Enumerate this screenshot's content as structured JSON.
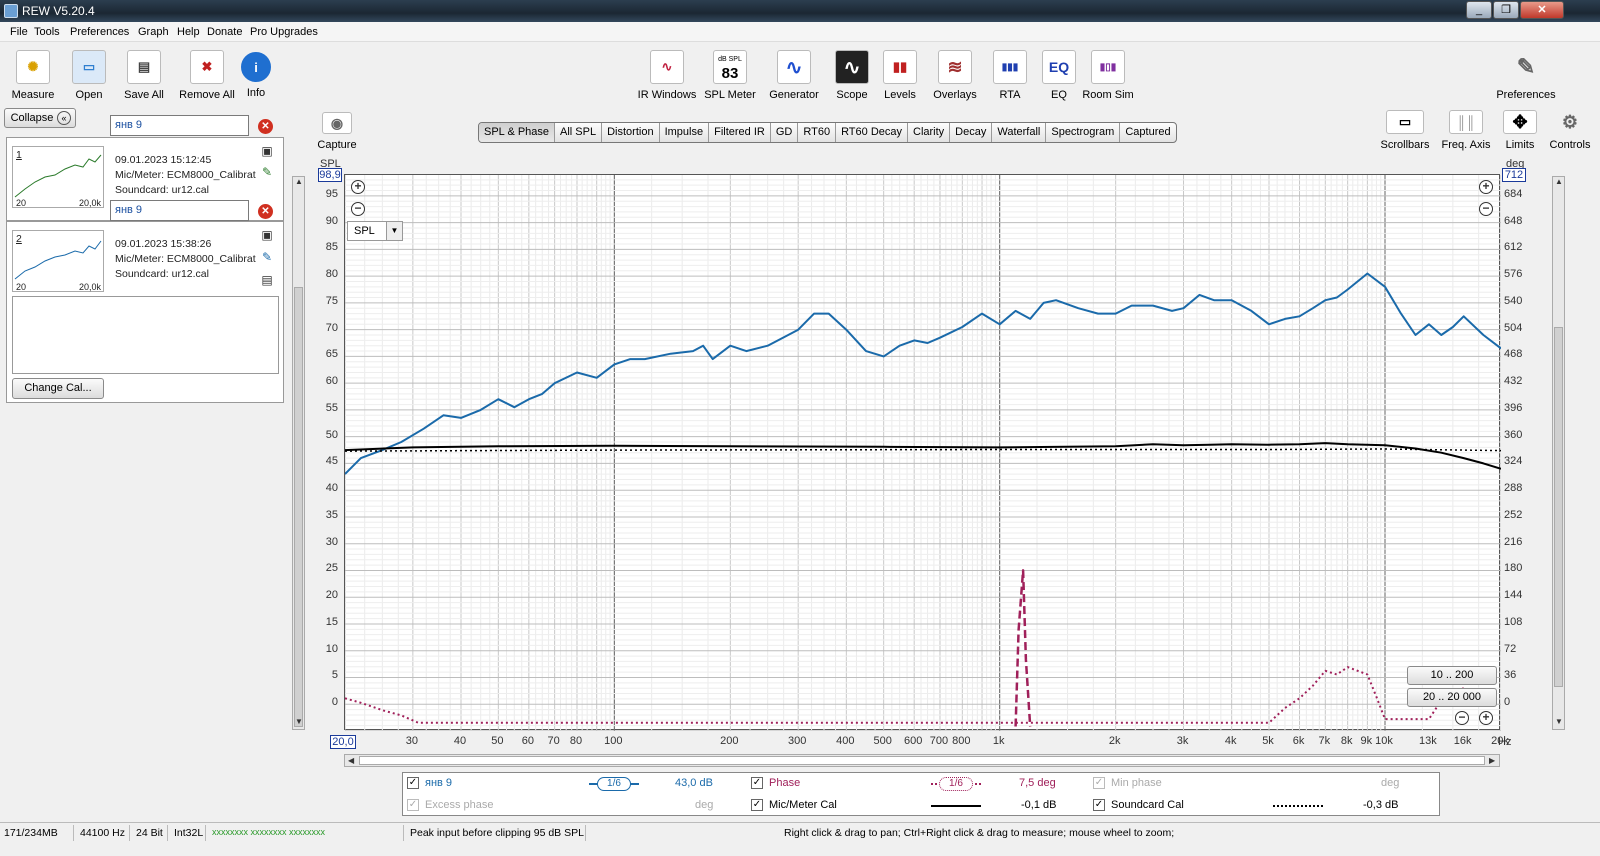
{
  "window": {
    "title": "REW V5.20.4",
    "controls": [
      "_",
      "❐",
      "✕"
    ]
  },
  "menu": [
    "File",
    "Tools",
    "Preferences",
    "Graph",
    "Help",
    "Donate",
    "Pro Upgrades"
  ],
  "toolbar_left": [
    {
      "label": "Measure",
      "icon": "measure-icon",
      "glyph": "✺"
    },
    {
      "label": "Open",
      "icon": "folder-icon",
      "glyph": "▭"
    },
    {
      "label": "Save All",
      "icon": "save-icon",
      "glyph": "▤"
    },
    {
      "label": "Remove All",
      "icon": "remove-icon",
      "glyph": "✖"
    },
    {
      "label": "Info",
      "icon": "info-icon",
      "glyph": "i"
    }
  ],
  "toolbar_center": [
    {
      "label": "IR Windows",
      "icon": "ir-windows-icon",
      "glyph": "∿"
    },
    {
      "label": "SPL Meter",
      "icon": "spl-meter-icon",
      "glyph": "83",
      "sub": "dB SPL"
    },
    {
      "label": "Generator",
      "icon": "generator-icon",
      "glyph": "∿"
    },
    {
      "label": "Scope",
      "icon": "scope-icon",
      "glyph": "∿"
    },
    {
      "label": "Levels",
      "icon": "levels-icon",
      "glyph": "▮▮"
    },
    {
      "label": "Overlays",
      "icon": "overlays-icon",
      "glyph": "≋"
    },
    {
      "label": "RTA",
      "icon": "rta-icon",
      "glyph": "▮▮▮"
    },
    {
      "label": "EQ",
      "icon": "eq-icon",
      "glyph": "EQ"
    },
    {
      "label": "Room Sim",
      "icon": "room-sim-icon",
      "glyph": "▮▯▮"
    }
  ],
  "toolbar_right": {
    "label": "Preferences",
    "icon": "wrench-icon",
    "glyph": "✎"
  },
  "graph_tools": [
    {
      "label": "Scrollbars",
      "icon": "scrollbars-icon",
      "glyph": "▭"
    },
    {
      "label": "Freq. Axis",
      "icon": "freq-axis-icon",
      "glyph": "║║"
    },
    {
      "label": "Limits",
      "icon": "limits-icon",
      "glyph": "✥"
    },
    {
      "label": "Controls",
      "icon": "gear-icon",
      "glyph": "⚙"
    }
  ],
  "capture": {
    "label": "Capture",
    "icon": "camera-icon",
    "glyph": "◉"
  },
  "collapse_label": "Collapse",
  "measurements": [
    {
      "num": "1",
      "name": "янв 9",
      "date": "09.01.2023 15:12:45",
      "mic": "Mic/Meter: ECM8000_Calibrat",
      "soundcard": "Soundcard: ur12.cal",
      "thumb_lo": "20",
      "thumb_hi": "20,0k",
      "color": "#2a7a2a"
    },
    {
      "num": "2",
      "name": "янв 9",
      "date": "09.01.2023 15:38:26",
      "mic": "Mic/Meter: ECM8000_Calibrat",
      "soundcard": "Soundcard: ur12.cal",
      "thumb_lo": "20",
      "thumb_hi": "20,0k",
      "color": "#1a6aaa"
    }
  ],
  "change_cal_label": "Change Cal...",
  "tabs": [
    "SPL & Phase",
    "All SPL",
    "Distortion",
    "Impulse",
    "Filtered IR",
    "GD",
    "RT60",
    "RT60 Decay",
    "Clarity",
    "Decay",
    "Waterfall",
    "Spectrogram",
    "Captured"
  ],
  "selected_tab": "SPL & Phase",
  "graph": {
    "left_axis_title": "SPL",
    "right_axis_title": "deg",
    "top_left_value": "98,9",
    "top_right_value": "712",
    "bottom_left_value": "20,0",
    "freq_unit": "Hz",
    "spl_selector": "SPL",
    "range_buttons": [
      "10 .. 200",
      "20 .. 20 000"
    ]
  },
  "chart_data": {
    "type": "line",
    "title": "",
    "xlabel": "",
    "ylabel": "SPL",
    "y2label": "deg",
    "x_scale": "log",
    "xlim": [
      20,
      20000
    ],
    "ylim": [
      -5,
      98.9
    ],
    "y2lim": [
      -36,
      712
    ],
    "grid": true,
    "x_ticks": [
      {
        "v": 30,
        "l": "30"
      },
      {
        "v": 40,
        "l": "40"
      },
      {
        "v": 50,
        "l": "50"
      },
      {
        "v": 60,
        "l": "60"
      },
      {
        "v": 70,
        "l": "70"
      },
      {
        "v": 80,
        "l": "80"
      },
      {
        "v": 100,
        "l": "100"
      },
      {
        "v": 200,
        "l": "200"
      },
      {
        "v": 300,
        "l": "300"
      },
      {
        "v": 400,
        "l": "400"
      },
      {
        "v": 500,
        "l": "500"
      },
      {
        "v": 600,
        "l": "600"
      },
      {
        "v": 700,
        "l": "700"
      },
      {
        "v": 800,
        "l": "800"
      },
      {
        "v": 1000,
        "l": "1k"
      },
      {
        "v": 2000,
        "l": "2k"
      },
      {
        "v": 3000,
        "l": "3k"
      },
      {
        "v": 4000,
        "l": "4k"
      },
      {
        "v": 5000,
        "l": "5k"
      },
      {
        "v": 6000,
        "l": "6k"
      },
      {
        "v": 7000,
        "l": "7k"
      },
      {
        "v": 8000,
        "l": "8k"
      },
      {
        "v": 9000,
        "l": "9k"
      },
      {
        "v": 10000,
        "l": "10k"
      },
      {
        "v": 13000,
        "l": "13k"
      },
      {
        "v": 16000,
        "l": "16k"
      },
      {
        "v": 20000,
        "l": "20k"
      }
    ],
    "y_ticks": [
      0,
      5,
      10,
      15,
      20,
      25,
      30,
      35,
      40,
      45,
      50,
      55,
      60,
      65,
      70,
      75,
      80,
      85,
      90,
      95
    ],
    "y2_ticks": [
      0,
      36,
      72,
      108,
      144,
      180,
      216,
      252,
      288,
      324,
      360,
      396,
      432,
      468,
      504,
      540,
      576,
      612,
      648,
      684
    ],
    "series": [
      {
        "name": "янв 9",
        "color": "#1a6aaa",
        "style": "solid",
        "width": 2,
        "x": [
          20,
          22,
          25,
          28,
          32,
          36,
          40,
          45,
          50,
          55,
          60,
          65,
          70,
          80,
          90,
          100,
          110,
          120,
          140,
          160,
          170,
          180,
          200,
          220,
          250,
          300,
          330,
          360,
          400,
          450,
          500,
          550,
          600,
          650,
          700,
          800,
          900,
          1000,
          1100,
          1200,
          1300,
          1400,
          1600,
          1800,
          2000,
          2200,
          2500,
          2800,
          3000,
          3300,
          3600,
          4000,
          4500,
          5000,
          5500,
          6000,
          6500,
          7000,
          7500,
          8000,
          9000,
          10000,
          11000,
          12000,
          13000,
          14000,
          15000,
          16000,
          18000,
          20000
        ],
        "y": [
          43,
          46,
          47.5,
          49,
          51.5,
          54,
          53.5,
          55,
          57,
          55.5,
          57,
          58,
          60,
          62,
          61,
          63.5,
          64.5,
          64.5,
          65.5,
          66,
          67,
          64.5,
          67,
          66,
          67,
          70,
          73,
          73,
          70,
          66,
          65,
          67,
          68,
          67.5,
          68.5,
          70.5,
          73,
          71,
          73.5,
          72,
          75,
          75.5,
          74,
          73,
          73,
          74.5,
          74.5,
          73.5,
          74,
          76.5,
          75.5,
          75.5,
          73.5,
          71,
          72,
          72.5,
          74,
          75.5,
          76,
          77.5,
          80.5,
          78,
          73,
          69,
          71,
          69,
          70.5,
          72.5,
          69,
          66.5
        ]
      },
      {
        "name": "Mic/Meter Cal",
        "color": "#000000",
        "style": "solid",
        "width": 2,
        "x": [
          20,
          30,
          50,
          100,
          200,
          500,
          1000,
          2000,
          2500,
          3000,
          3500,
          4000,
          5000,
          6000,
          7000,
          8000,
          10000,
          12000,
          14000,
          16000,
          18000,
          20000
        ],
        "y": [
          47.5,
          48,
          48.2,
          48.3,
          48.2,
          48.1,
          48,
          48.2,
          48.6,
          48.4,
          48.5,
          48.6,
          48.5,
          48.6,
          48.8,
          48.6,
          48.4,
          47.8,
          47,
          46,
          45,
          44
        ]
      },
      {
        "name": "Soundcard Cal",
        "color": "#000000",
        "style": "dotted",
        "width": 1.5,
        "x": [
          20,
          100,
          1000,
          5000,
          10000,
          20000
        ],
        "y": [
          47.3,
          47.5,
          47.6,
          47.6,
          47.7,
          47.4
        ]
      },
      {
        "name": "Phase",
        "color": "#a0205a",
        "style": "dotted",
        "width": 2,
        "axis": "y2",
        "x": [
          20,
          22,
          25,
          28,
          31,
          5000,
          5500,
          6000,
          6500,
          7000,
          7500,
          8000,
          9000,
          9500,
          10000,
          13000,
          14000,
          15000,
          16000
        ],
        "y": [
          8,
          2,
          -8,
          -15,
          -25,
          -25,
          -5,
          8,
          25,
          45,
          40,
          50,
          40,
          10,
          -20,
          -20,
          5,
          10,
          22
        ]
      },
      {
        "name": "Phase spike",
        "color": "#a0205a",
        "style": "dashed",
        "width": 2.5,
        "axis": "y2",
        "x": [
          1100,
          1120,
          1150,
          1170,
          1200
        ],
        "y": [
          -30,
          100,
          180,
          60,
          -30
        ]
      }
    ]
  },
  "legend": {
    "rows": [
      [
        {
          "checked": true,
          "name": "янв 9",
          "color": "#1a6aaa",
          "smooth": "1/6",
          "value": "43,0 dB",
          "disabled": false
        },
        {
          "checked": true,
          "name": "Phase",
          "color": "#a0205a",
          "smooth": "1/6",
          "value": "7,5 deg",
          "disabled": false
        },
        {
          "checked": true,
          "name": "Min phase",
          "color": "#aaaaaa",
          "value": "deg",
          "disabled": true
        }
      ],
      [
        {
          "checked": true,
          "name": "Excess phase",
          "color": "#aaaaaa",
          "value": "deg",
          "disabled": true
        },
        {
          "checked": true,
          "name": "Mic/Meter Cal",
          "color": "#000000",
          "value": "-0,1 dB",
          "disabled": false
        },
        {
          "checked": true,
          "name": "Soundcard Cal",
          "color": "#000000",
          "value": "-0,3 dB",
          "disabled": false
        }
      ]
    ]
  },
  "status": {
    "memory": "171/234MB",
    "rate": "44100 Hz",
    "bits": "24 Bit",
    "format": "Int32L",
    "meters": "xxxxxxxx xxxxxxxx xxxxxxxx",
    "peak": "Peak input before clipping 95 dB SPL",
    "hint": "Right click & drag to pan; Ctrl+Right click & drag to measure; mouse wheel to zoom;"
  }
}
